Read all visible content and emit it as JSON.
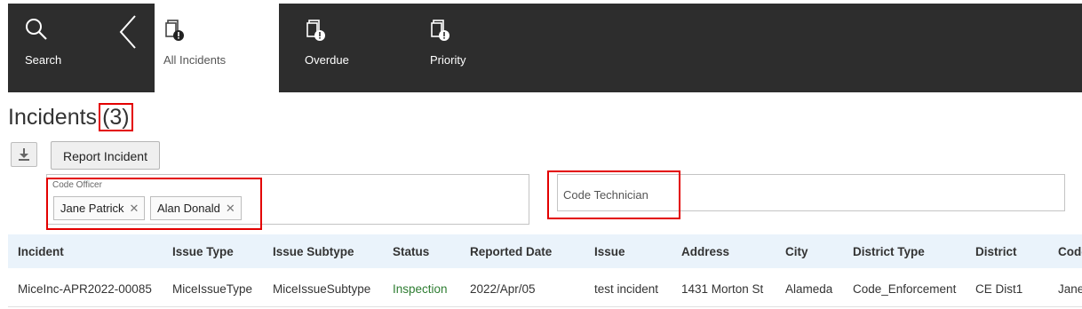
{
  "nav": {
    "search_label": "Search",
    "tabs": [
      {
        "label": "All Incidents",
        "icon": "incident-list-icon",
        "active": true
      },
      {
        "label": "Overdue",
        "icon": "incident-list-icon"
      },
      {
        "label": "Priority",
        "icon": "incident-list-icon"
      }
    ]
  },
  "page": {
    "title": "Incidents",
    "count": "(3)"
  },
  "toolbar": {
    "download_icon": "download-icon",
    "report_label": "Report Incident"
  },
  "filters": {
    "code_officer_label": "Code Officer",
    "code_officer_chips": [
      "Jane Patrick",
      "Alan Donald"
    ],
    "chip_remove_glyph": "✕",
    "code_technician_placeholder": "Code Technician"
  },
  "table": {
    "columns": [
      "Incident",
      "Issue Type",
      "Issue Subtype",
      "Status",
      "Reported Date",
      "Issue",
      "Address",
      "City",
      "District Type",
      "District",
      "Code"
    ],
    "rows": [
      [
        "MiceInc-APR2022-00085",
        "MiceIssueType",
        "MiceIssueSubtype",
        "Inspection",
        "2022/Apr/05",
        "test incident",
        "1431 Morton St",
        "Alameda",
        "Code_Enforcement",
        "CE Dist1",
        "Jane"
      ]
    ]
  },
  "colors": {
    "nav_bg": "#2d2d2d",
    "header_bg": "#eaf3fb",
    "status_green": "#2e7d32",
    "highlight_red": "#e30000"
  }
}
